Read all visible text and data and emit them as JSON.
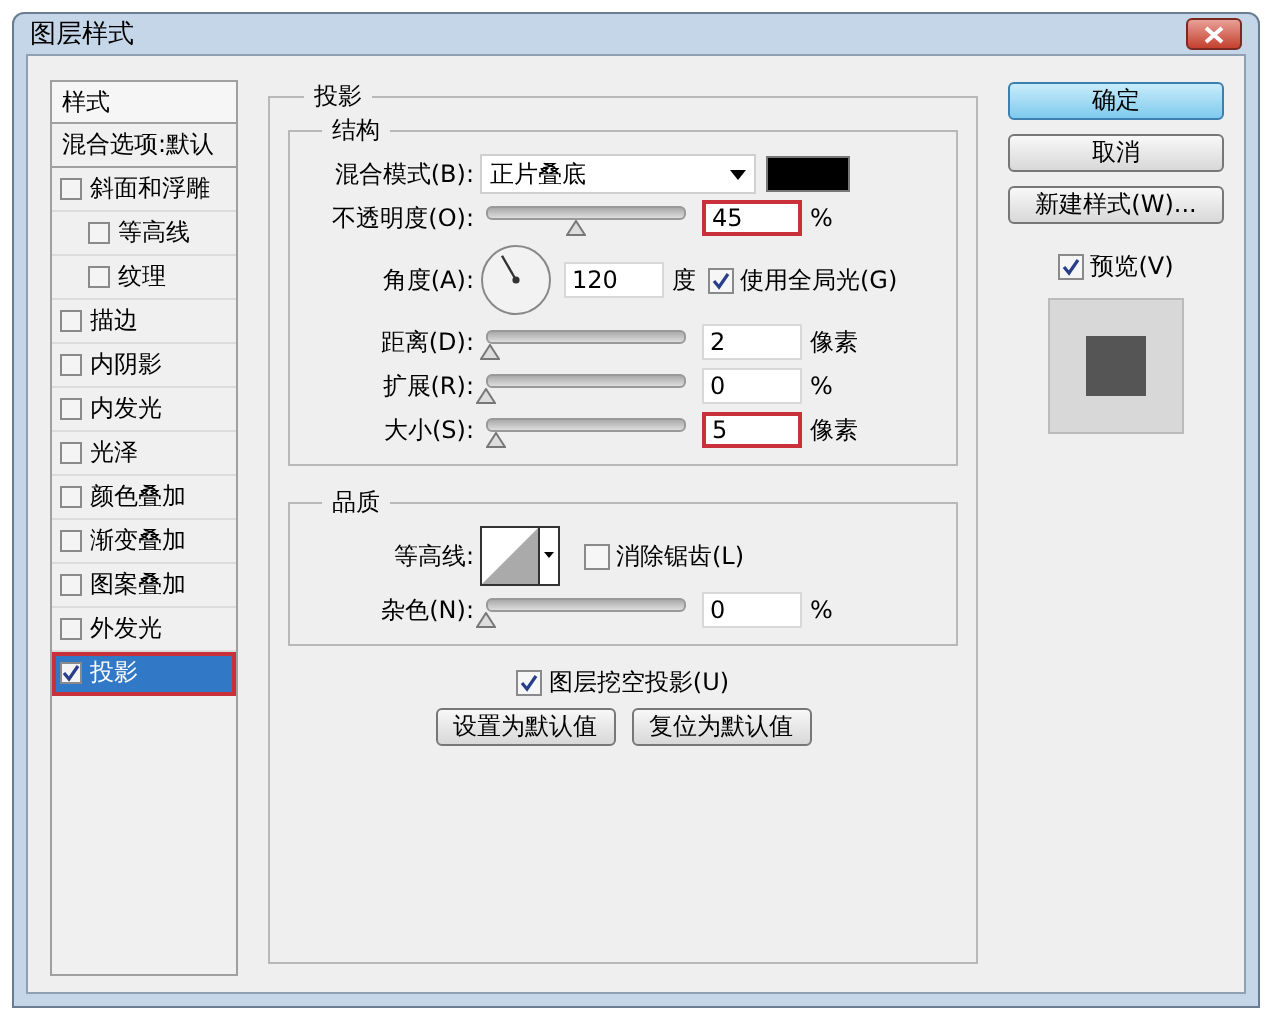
{
  "window": {
    "title": "图层样式"
  },
  "sidebar": {
    "header": "样式",
    "items": [
      {
        "kind": "option",
        "label": "混合选项:默认",
        "selected": false
      },
      {
        "kind": "check",
        "label": "斜面和浮雕",
        "checked": false,
        "selected": false,
        "children": [
          {
            "kind": "check",
            "label": "等高线",
            "checked": false,
            "selected": false
          },
          {
            "kind": "check",
            "label": "纹理",
            "checked": false,
            "selected": false
          }
        ]
      },
      {
        "kind": "check",
        "label": "描边",
        "checked": false,
        "selected": false
      },
      {
        "kind": "check",
        "label": "内阴影",
        "checked": false,
        "selected": false
      },
      {
        "kind": "check",
        "label": "内发光",
        "checked": false,
        "selected": false
      },
      {
        "kind": "check",
        "label": "光泽",
        "checked": false,
        "selected": false
      },
      {
        "kind": "check",
        "label": "颜色叠加",
        "checked": false,
        "selected": false
      },
      {
        "kind": "check",
        "label": "渐变叠加",
        "checked": false,
        "selected": false
      },
      {
        "kind": "check",
        "label": "图案叠加",
        "checked": false,
        "selected": false
      },
      {
        "kind": "check",
        "label": "外发光",
        "checked": false,
        "selected": false
      },
      {
        "kind": "check",
        "label": "投影",
        "checked": true,
        "selected": true
      }
    ]
  },
  "drop_shadow": {
    "title": "投影",
    "structure": {
      "title": "结构",
      "rows": [
        {
          "kind": "select",
          "label": "混合模式(B):",
          "value": "正片叠底",
          "color": "#000000"
        },
        {
          "kind": "slider",
          "label": "不透明度(O):",
          "level": 0.45,
          "value": "45",
          "unit": "%",
          "highlighted": true
        },
        {
          "kind": "angle",
          "label": "角度(A):",
          "value": "120",
          "unit": "度",
          "global_light": {
            "label": "使用全局光(G)",
            "checked": true
          }
        },
        {
          "kind": "slider",
          "label": "距离(D):",
          "level": 0.02,
          "value": "2",
          "unit": "像素",
          "highlighted": false
        },
        {
          "kind": "slider",
          "label": "扩展(R):",
          "level": 0,
          "value": "0",
          "unit": "%",
          "highlighted": false
        },
        {
          "kind": "slider",
          "label": "大小(S):",
          "level": 0.05,
          "value": "5",
          "unit": "像素",
          "highlighted": true
        }
      ]
    },
    "quality": {
      "title": "品质",
      "contour": {
        "label": "等高线:",
        "anti_alias": {
          "label": "消除锯齿(L)",
          "checked": false
        }
      },
      "noise": {
        "label": "杂色(N):",
        "level": 0,
        "value": "0",
        "unit": "%",
        "highlighted": false
      }
    },
    "knockout": {
      "label": "图层挖空投影(U)",
      "checked": true
    },
    "buttons": [
      "设置为默认值",
      "复位为默认值"
    ]
  },
  "dialog_buttons": [
    {
      "label": "确定",
      "default": true
    },
    {
      "label": "取消",
      "default": false
    },
    {
      "label": "新建样式(W)...",
      "default": false
    }
  ],
  "preview": {
    "label": "预览(V)",
    "checked": true
  }
}
